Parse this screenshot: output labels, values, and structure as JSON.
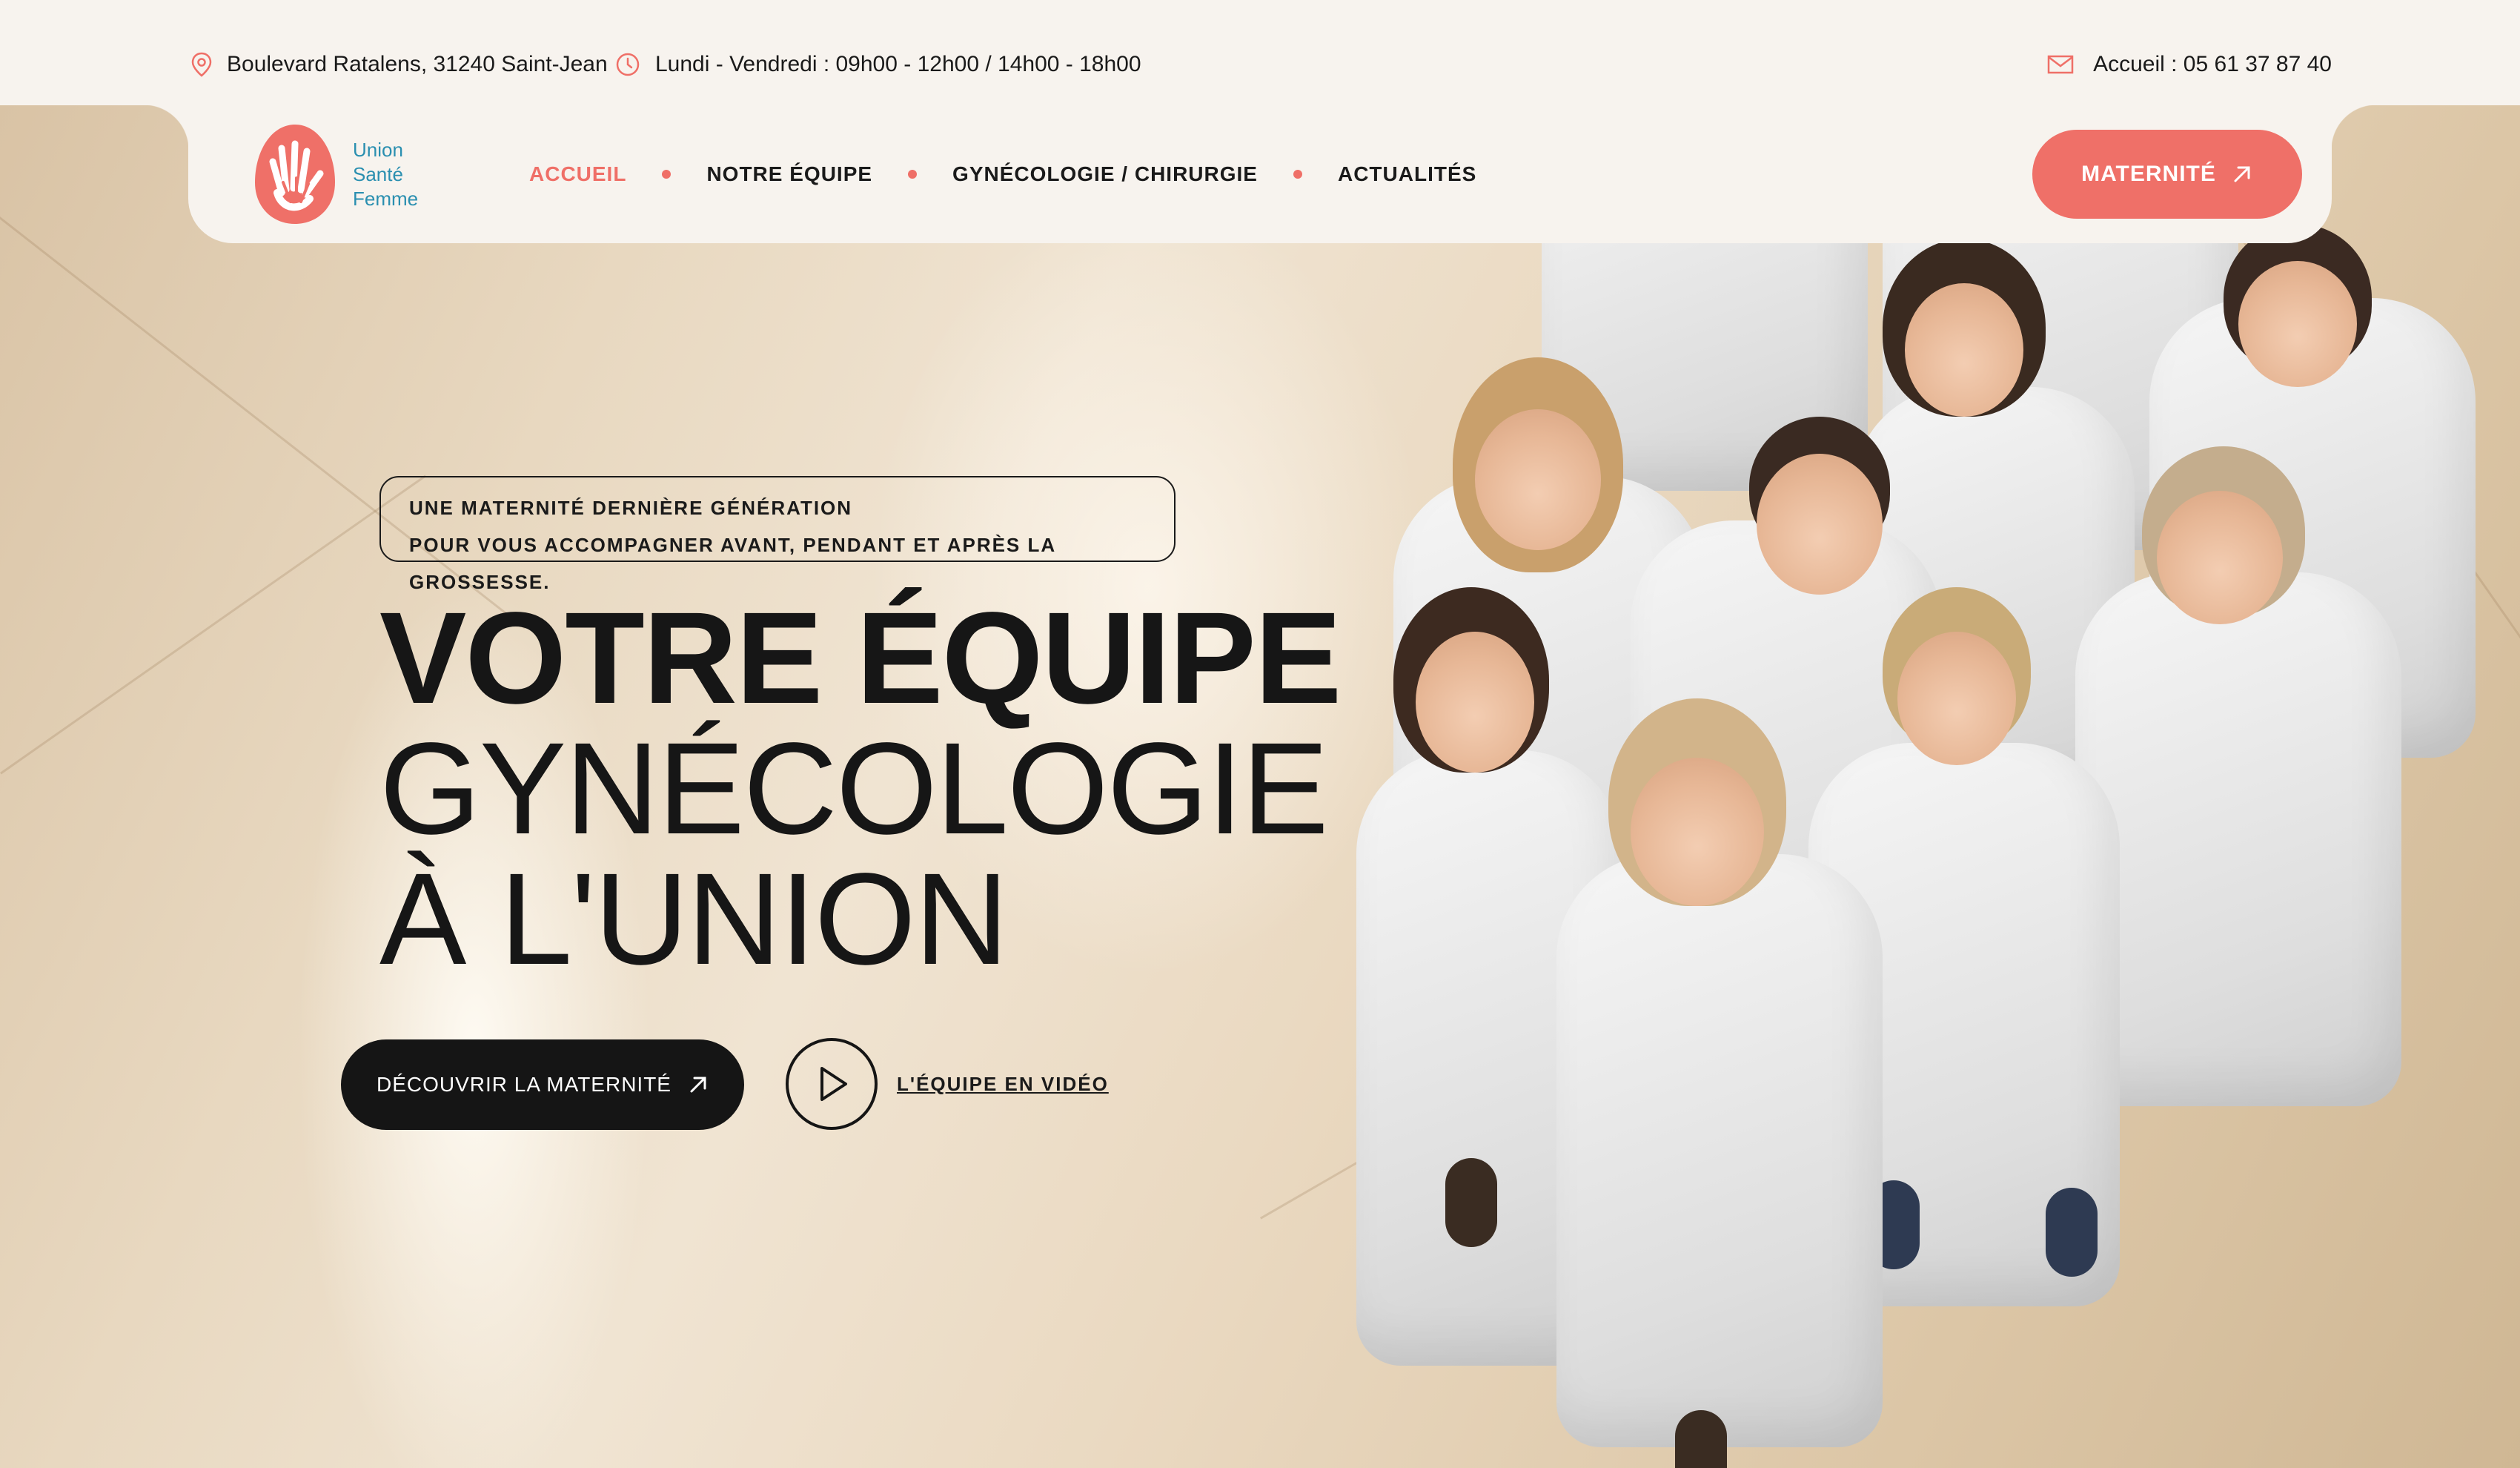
{
  "topbar": {
    "address": "Boulevard Ratalens, 31240 Saint-Jean",
    "hours": "Lundi - Vendredi : 09h00 - 12h00 / 14h00 - 18h00",
    "phone": "Accueil : 05 61 37 87 40",
    "icons": [
      "location-pin-icon",
      "clock-icon",
      "mail-icon"
    ]
  },
  "logo": {
    "line1": "Union",
    "line2": "Santé",
    "line3": "Femme",
    "icon": "hands-logo-icon"
  },
  "nav": {
    "items": [
      {
        "label": "ACCUEIL",
        "active": true
      },
      {
        "label": "NOTRE ÉQUIPE",
        "active": false
      },
      {
        "label": "GYNÉCOLOGIE / CHIRURGIE",
        "active": false
      },
      {
        "label": "ACTUALITÉS",
        "active": false
      }
    ],
    "cta": "MATERNITÉ"
  },
  "hero": {
    "tagline_line1": "UNE MATERNITÉ DERNIÈRE GÉNÉRATION",
    "tagline_line2": "POUR VOUS ACCOMPAGNER AVANT, PENDANT ET APRÈS LA GROSSESSE.",
    "headline_line1": "VOTRE ÉQUIPE",
    "headline_line2": "GYNÉCOLOGIE",
    "headline_line3": "À L'UNION",
    "primary_button": "DÉCOUVRIR LA MATERNITÉ",
    "video_link": "L'ÉQUIPE EN VIDÉO"
  },
  "colors": {
    "accent": "#ef7068",
    "background": "#f7f3ee",
    "dark": "#151515",
    "logo_text": "#2a8fb0"
  }
}
